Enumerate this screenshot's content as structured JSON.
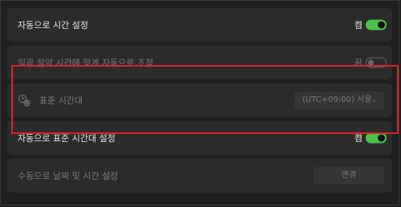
{
  "settings": {
    "auto_time": {
      "label": "자동으로 시간 설정",
      "state": "켬"
    },
    "dst": {
      "label": "일광 절약 시간에 맞게 자동으로 조정",
      "state": "끔"
    },
    "timezone": {
      "label": "표준 시간대",
      "value": "(UTC+09:00) 서울",
      "chevron": "⌄"
    },
    "auto_timezone": {
      "label": "자동으로 표준 시간대 설정",
      "state": "켬"
    },
    "manual": {
      "label": "수동으로 날짜 및 시간 설정",
      "button": "변경"
    }
  },
  "colors": {
    "accent": "#4cc24c",
    "highlight": "#d9252a"
  },
  "icons": {
    "timezone": "clock-globe-icon",
    "chevron": "chevron-down-icon"
  }
}
